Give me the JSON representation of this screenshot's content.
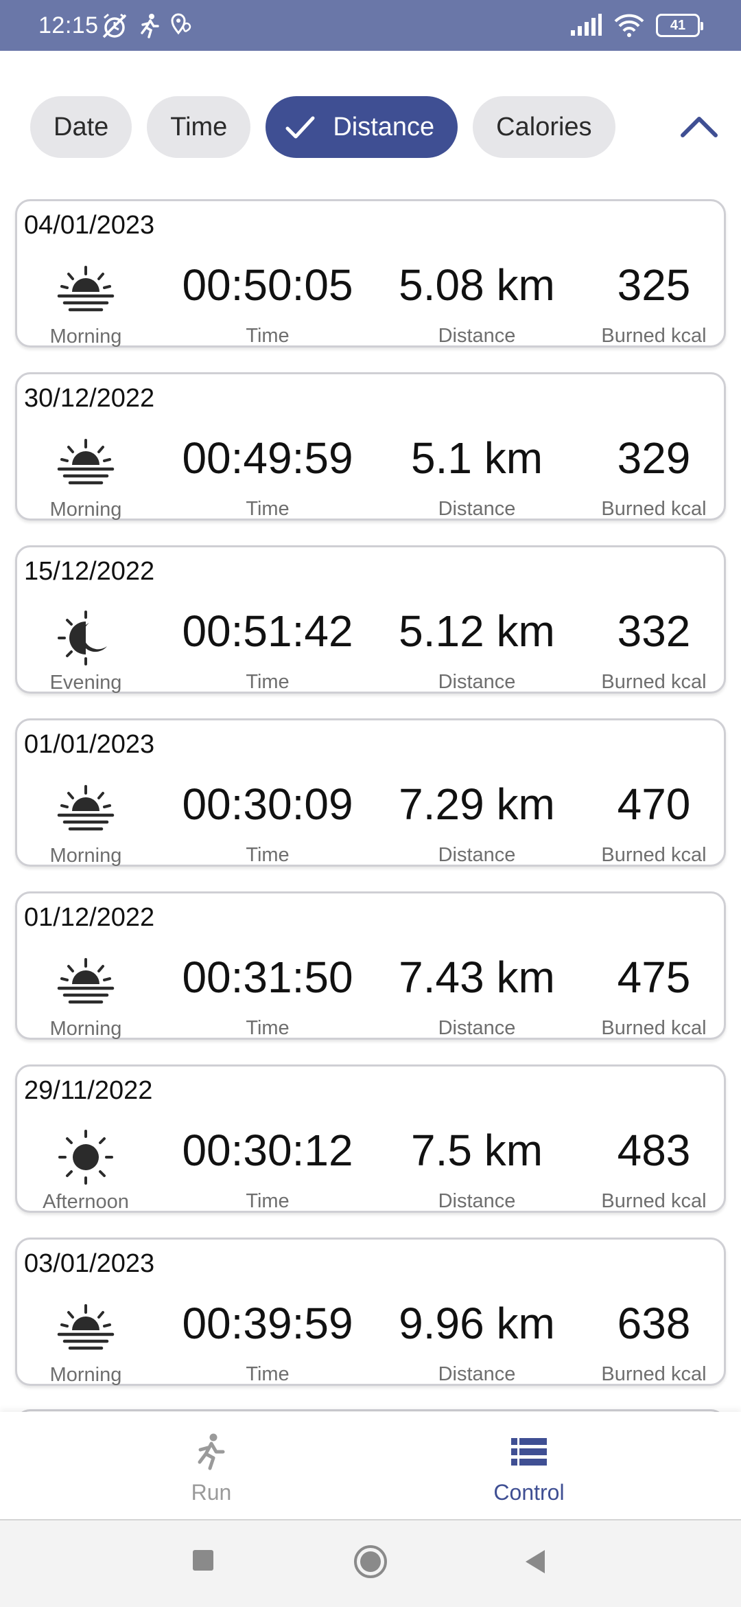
{
  "status_bar": {
    "time": "12:15",
    "battery": "41",
    "background_color": "#6a77a8"
  },
  "filters": {
    "chips": [
      {
        "label": "Date",
        "selected": false
      },
      {
        "label": "Time",
        "selected": false
      },
      {
        "label": "Distance",
        "selected": true
      },
      {
        "label": "Calories",
        "selected": false
      }
    ],
    "accent_color": "#3f4f93",
    "collapse_icon": "chevron-up-icon"
  },
  "runs": [
    {
      "date": "04/01/2023",
      "time_of_day": "Morning",
      "icon": "sunrise-icon",
      "duration": "00:50:05",
      "duration_label": "Time",
      "distance": "5.08 km",
      "distance_label": "Distance",
      "kcal": "325",
      "kcal_label": "Burned kcal"
    },
    {
      "date": "30/12/2022",
      "time_of_day": "Morning",
      "icon": "sunrise-icon",
      "duration": "00:49:59",
      "duration_label": "Time",
      "distance": "5.1 km",
      "distance_label": "Distance",
      "kcal": "329",
      "kcal_label": "Burned kcal"
    },
    {
      "date": "15/12/2022",
      "time_of_day": "Evening",
      "icon": "sun-moon-icon",
      "duration": "00:51:42",
      "duration_label": "Time",
      "distance": "5.12 km",
      "distance_label": "Distance",
      "kcal": "332",
      "kcal_label": "Burned kcal"
    },
    {
      "date": "01/01/2023",
      "time_of_day": "Morning",
      "icon": "sunrise-icon",
      "duration": "00:30:09",
      "duration_label": "Time",
      "distance": "7.29 km",
      "distance_label": "Distance",
      "kcal": "470",
      "kcal_label": "Burned kcal"
    },
    {
      "date": "01/12/2022",
      "time_of_day": "Morning",
      "icon": "sunrise-icon",
      "duration": "00:31:50",
      "duration_label": "Time",
      "distance": "7.43 km",
      "distance_label": "Distance",
      "kcal": "475",
      "kcal_label": "Burned kcal"
    },
    {
      "date": "29/11/2022",
      "time_of_day": "Afternoon",
      "icon": "sun-icon",
      "duration": "00:30:12",
      "duration_label": "Time",
      "distance": "7.5 km",
      "distance_label": "Distance",
      "kcal": "483",
      "kcal_label": "Burned kcal"
    },
    {
      "date": "03/01/2023",
      "time_of_day": "Morning",
      "icon": "sunrise-icon",
      "duration": "00:39:59",
      "duration_label": "Time",
      "distance": "9.96 km",
      "distance_label": "Distance",
      "kcal": "638",
      "kcal_label": "Burned kcal"
    }
  ],
  "bottom_nav": {
    "items": [
      {
        "label": "Run",
        "icon": "running-icon",
        "active": false
      },
      {
        "label": "Control",
        "icon": "list-icon",
        "active": true
      }
    ]
  },
  "system_nav": {
    "buttons": [
      "recents-icon",
      "home-icon",
      "back-icon"
    ]
  }
}
